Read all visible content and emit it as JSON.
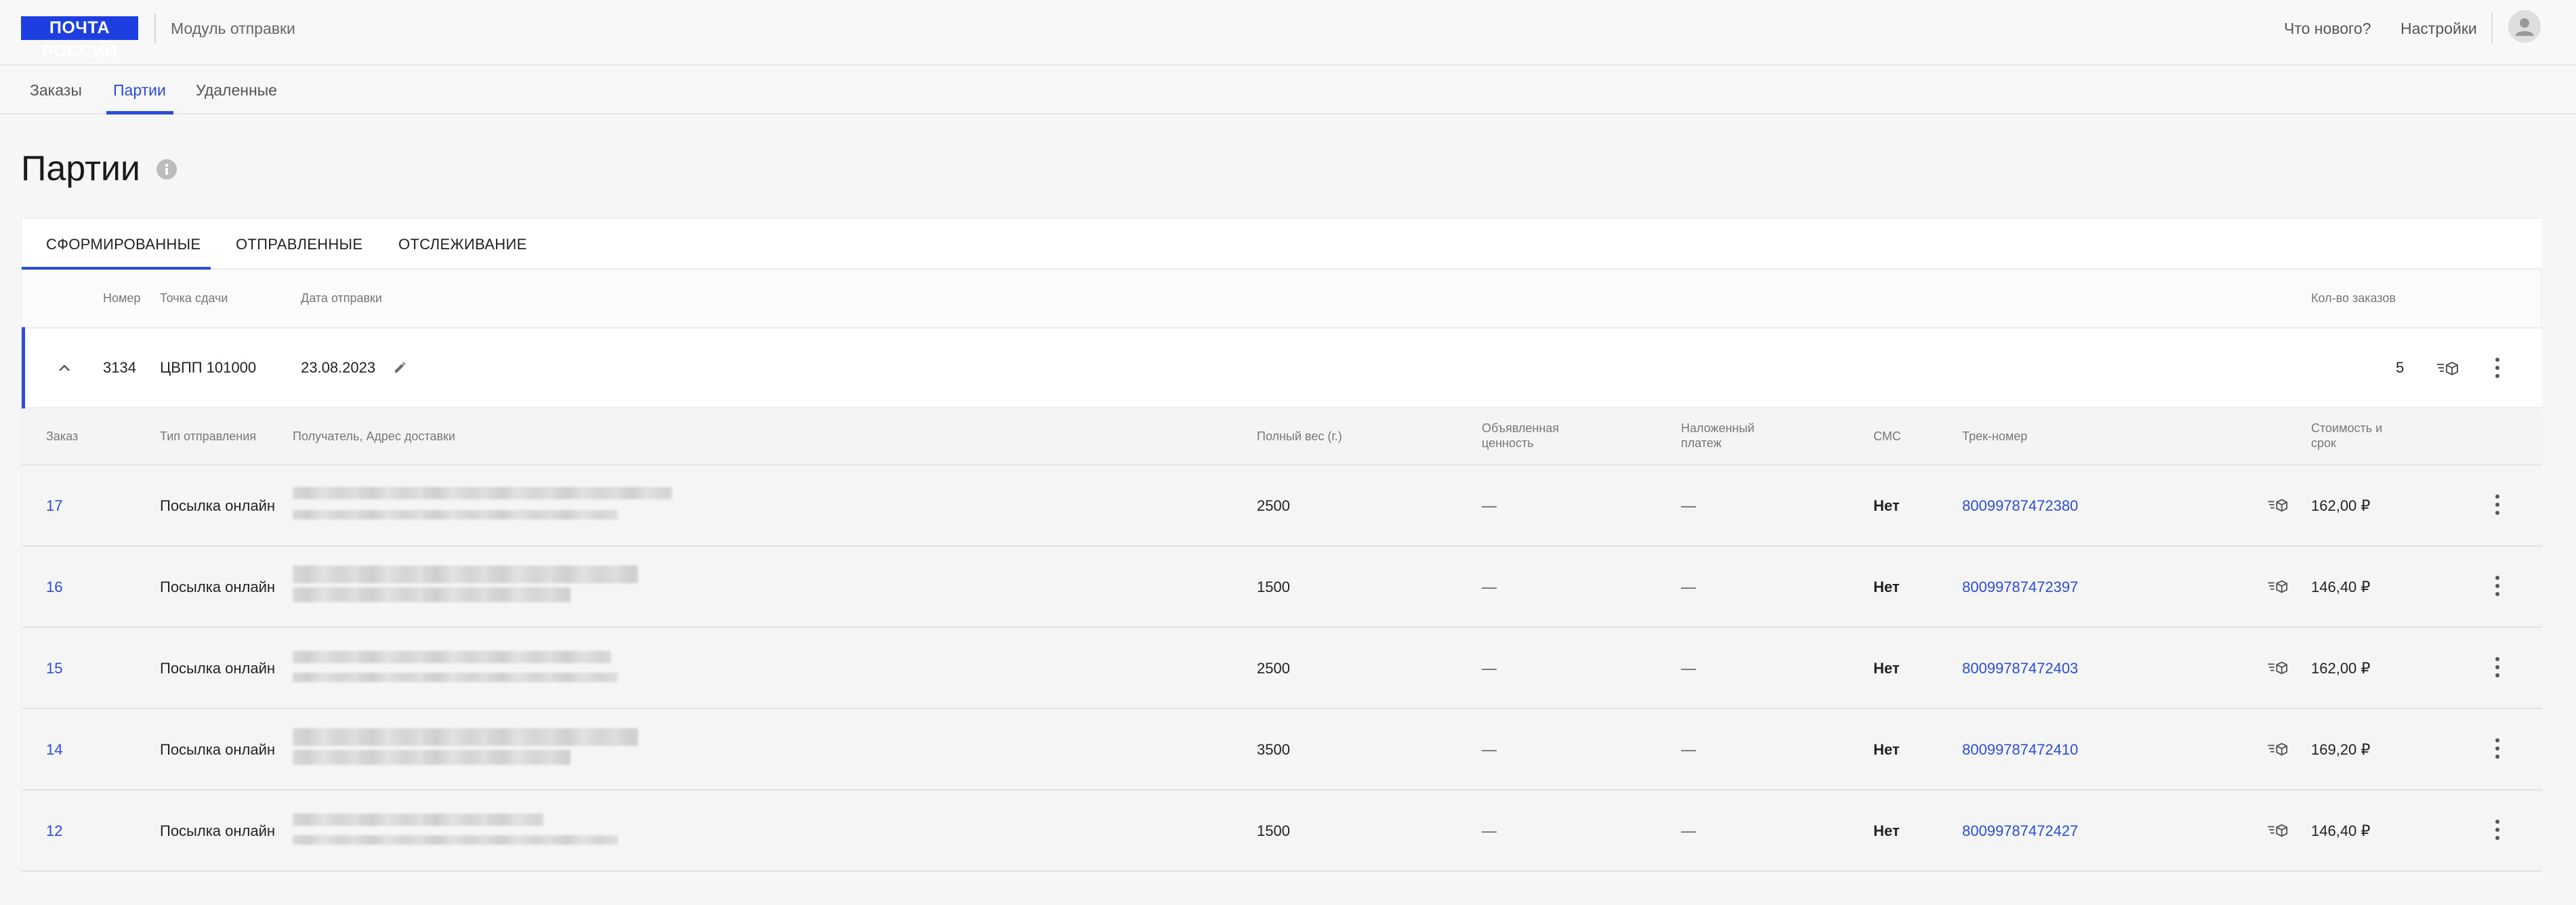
{
  "header": {
    "logo_text": "ПОЧТА РОССИИ",
    "module_title": "Модуль отправки",
    "whats_new": "Что нового?",
    "settings": "Настройки"
  },
  "nav": {
    "tabs": [
      {
        "label": "Заказы"
      },
      {
        "label": "Партии"
      },
      {
        "label": "Удаленные"
      }
    ],
    "active": "Партии"
  },
  "page": {
    "title": "Партии"
  },
  "subtabs": [
    {
      "label": "СФОРМИРОВАННЫЕ"
    },
    {
      "label": "ОТПРАВЛЕННЫЕ"
    },
    {
      "label": "ОТСЛЕЖИВАНИЕ"
    }
  ],
  "batch_headers": {
    "number": "Номер",
    "point": "Точка сдачи",
    "date": "Дата отправки",
    "count": "Кол-во заказов"
  },
  "batch": {
    "number": "3134",
    "point": "ЦВПП 101000",
    "date": "23.08.2023",
    "count": "5"
  },
  "order_headers": {
    "order": "Заказ",
    "type": "Тип отправления",
    "recipient": "Получатель, Адрес доставки",
    "weight": "Полный вес (г.)",
    "declared_1": "Объявленная",
    "declared_2": "ценность",
    "cod_1": "Наложенный",
    "cod_2": "платеж",
    "sms": "СМС",
    "track": "Трек-номер",
    "cost_1": "Стоимость и",
    "cost_2": "срок"
  },
  "orders": [
    {
      "id": "17",
      "type": "Посылка онлайн",
      "weight": "2500",
      "declared": "—",
      "cod": "—",
      "sms": "Нет",
      "track": "80099787472380",
      "cost": "162,00 ₽"
    },
    {
      "id": "16",
      "type": "Посылка онлайн",
      "weight": "1500",
      "declared": "—",
      "cod": "—",
      "sms": "Нет",
      "track": "80099787472397",
      "cost": "146,40 ₽"
    },
    {
      "id": "15",
      "type": "Посылка онлайн",
      "weight": "2500",
      "declared": "—",
      "cod": "—",
      "sms": "Нет",
      "track": "80099787472403",
      "cost": "162,00 ₽"
    },
    {
      "id": "14",
      "type": "Посылка онлайн",
      "weight": "3500",
      "declared": "—",
      "cod": "—",
      "sms": "Нет",
      "track": "80099787472410",
      "cost": "169,20 ₽"
    },
    {
      "id": "12",
      "type": "Посылка онлайн",
      "weight": "1500",
      "declared": "—",
      "cod": "—",
      "sms": "Нет",
      "track": "80099787472427",
      "cost": "146,40 ₽"
    }
  ],
  "colors": {
    "accent": "#2a4cd8",
    "logo_bg": "#1d3ee0"
  }
}
